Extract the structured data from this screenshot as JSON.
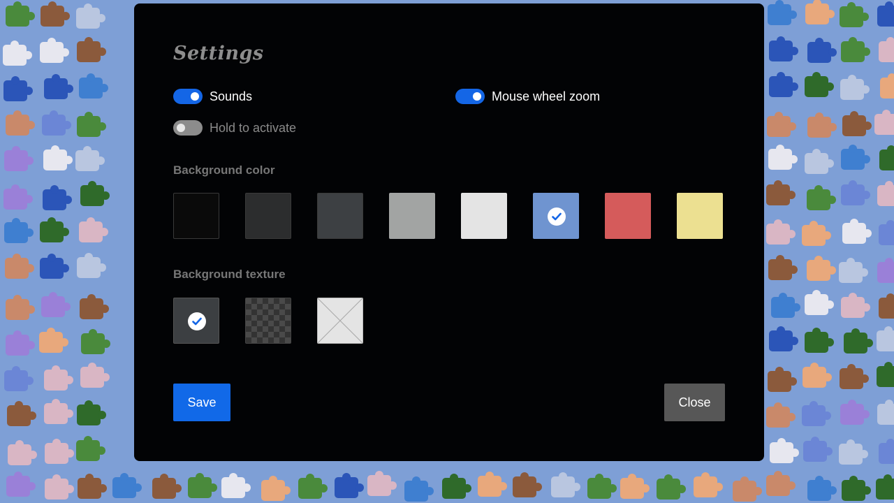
{
  "settings": {
    "title": "Settings",
    "toggles": {
      "sounds": {
        "label": "Sounds",
        "on": true
      },
      "mouse_wheel_zoom": {
        "label": "Mouse wheel zoom",
        "on": true
      },
      "hold_to_activate": {
        "label": "Hold to activate",
        "on": false
      }
    },
    "background_color": {
      "label": "Background color",
      "options": [
        "#0a0a0a",
        "#2c2d2e",
        "#3d4043",
        "#a2a4a3",
        "#e4e4e4",
        "#6f94d0",
        "#d55b5b",
        "#ece091"
      ],
      "selected_index": 5
    },
    "background_texture": {
      "label": "Background texture",
      "options": [
        "solid-dark",
        "checkerboard",
        "none"
      ],
      "selected_index": 0
    },
    "buttons": {
      "save": "Save",
      "close": "Close"
    }
  },
  "colors": {
    "backdrop": "#7e9fd6",
    "accent": "#1466e6",
    "modal_bg": "#020305"
  },
  "icons": [
    "check-icon",
    "puzzle-piece-icon",
    "no-texture-icon"
  ]
}
